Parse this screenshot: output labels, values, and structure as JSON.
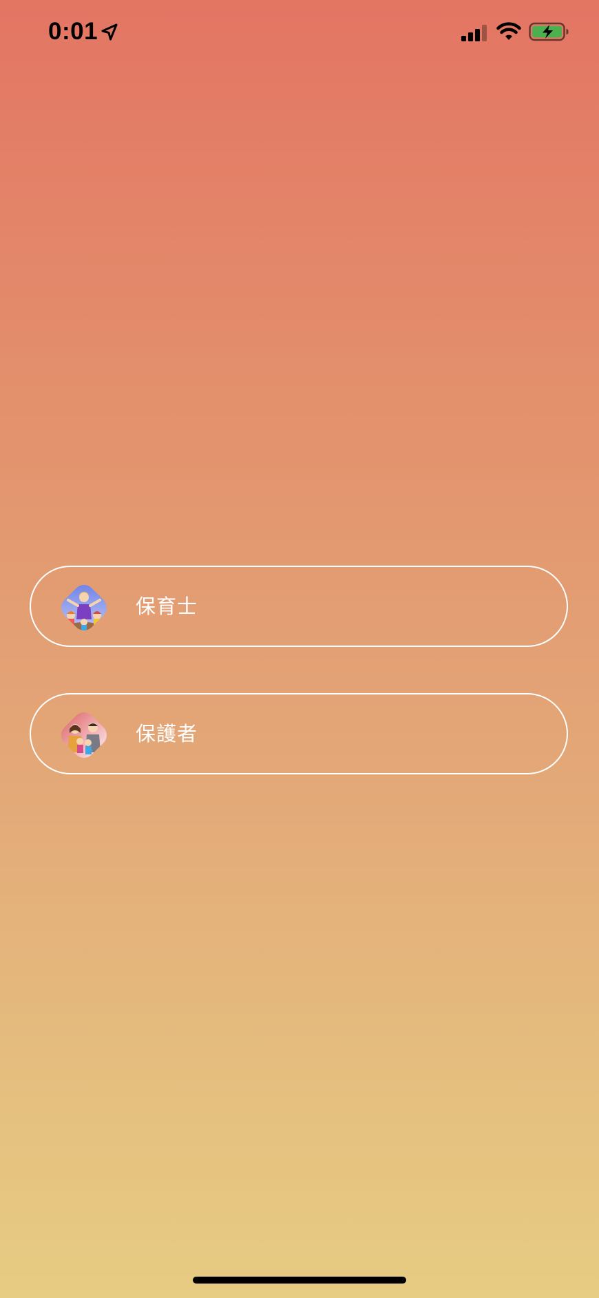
{
  "status_bar": {
    "time": "0:01",
    "icons": [
      "location-arrow-icon",
      "cellular-signal-icon",
      "wifi-icon",
      "battery-charging-icon"
    ]
  },
  "roles": [
    {
      "label": "保育士",
      "avatar": "teacher-with-children-illustration"
    },
    {
      "label": "保護者",
      "avatar": "family-illustration"
    }
  ],
  "colors": {
    "background_top": "#e37563",
    "background_bottom": "#e7cc83",
    "button_border": "#ffffff",
    "button_text": "#ffffff",
    "battery_fill": "#4caf50"
  }
}
